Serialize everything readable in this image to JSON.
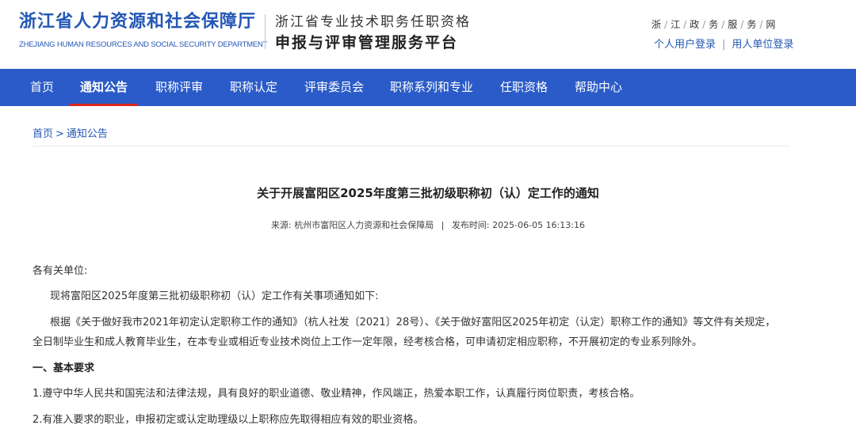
{
  "header": {
    "department_cn": "浙江省人力资源和社会保障厅",
    "department_en": "ZHEJIANG HUMAN RESOURCES AND SOCIAL SECURITY DEPARTMENT",
    "platform_line1": "浙江省专业技术职务任职资格",
    "platform_line2": "申报与评审管理服务平台",
    "gov_link_chars": [
      "浙",
      "江",
      "政",
      "务",
      "服",
      "务",
      "网"
    ],
    "personal_login": "个人用户登录",
    "unit_login": "用人单位登录",
    "login_separator": "|"
  },
  "nav": {
    "items": [
      {
        "label": "首页"
      },
      {
        "label": "通知公告"
      },
      {
        "label": "职称评审"
      },
      {
        "label": "职称认定"
      },
      {
        "label": "评审委员会"
      },
      {
        "label": "职称系列和专业"
      },
      {
        "label": "任职资格"
      },
      {
        "label": "帮助中心"
      }
    ],
    "active_item": "通知公告",
    "colors": {
      "bar": "#2a5bc8",
      "active_underline": "#e0251b"
    }
  },
  "breadcrumb": {
    "home": "首页",
    "separator": ">",
    "current": "通知公告"
  },
  "article": {
    "title": "关于开展富阳区2025年度第三批初级职称初（认）定工作的通知",
    "source_label": "来源:",
    "source": "杭州市富阳区人力资源和社会保障局",
    "meta_separator": "|",
    "publish_label": "发布时间:",
    "publish_time": "2025-06-05 16:13:16",
    "greeting": "各有关单位:",
    "intro": "现将富阳区2025年度第三批初级职称初（认）定工作有关事项通知如下:",
    "basis_line1": "根据《关于做好我市2021年初定认定职称工作的通知》（杭人社发〔2021〕28号）、《关于做好富阳区2025年初定（认定）职称工作的通知》等文件有关规定，",
    "basis_line2": "全日制毕业生和成人教育毕业生，在本专业或相近专业技术岗位上工作一定年限，经考核合格，可申请初定相应职称，不开展初定的专业系列除外。",
    "section_heading": "一、基本要求",
    "requirement_1": "1.遵守中华人民共和国宪法和法律法规，具有良好的职业道德、敬业精神，作风端正，热爱本职工作，认真履行岗位职责，考核合格。",
    "requirement_2": "2.有准入要求的职业，申报初定或认定助理级以上职称应先取得相应有效的职业资格。"
  }
}
